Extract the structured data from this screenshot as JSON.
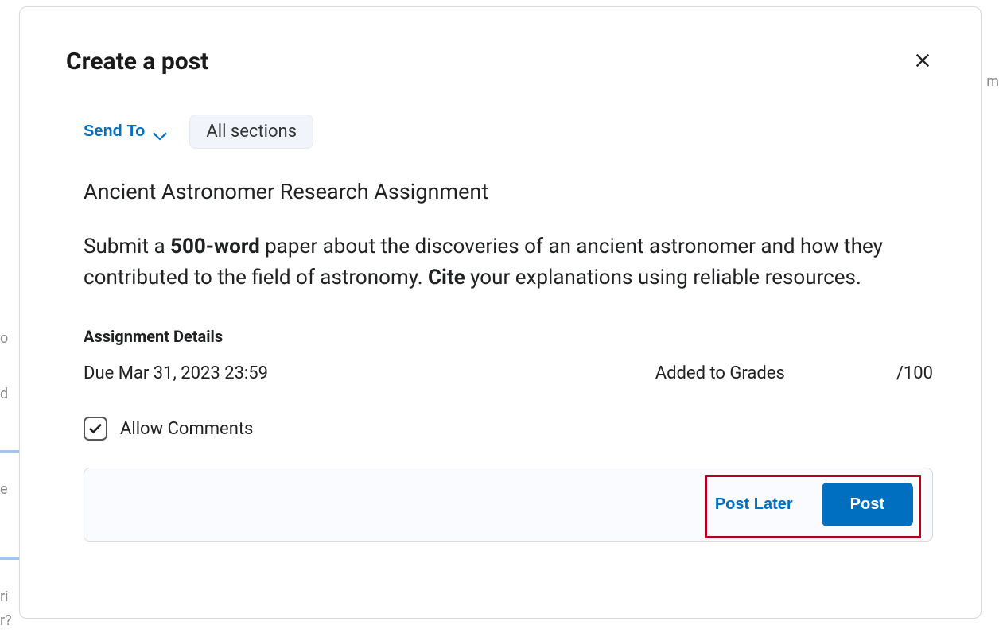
{
  "modal": {
    "title": "Create a post",
    "send_to_label": "Send To",
    "sections_pill": "All sections"
  },
  "post": {
    "title": "Ancient Astronomer Research Assignment",
    "body_prefix": "Submit a ",
    "body_bold1": "500-word",
    "body_mid": " paper about the discoveries of an ancient astronomer and how they contributed to the field of astronomy. ",
    "body_bold2": "Cite",
    "body_suffix": " your explanations using reliable resources."
  },
  "details": {
    "heading": "Assignment Details",
    "due": "Due Mar 31, 2023 23:59",
    "grades": "Added to Grades",
    "max": "/100"
  },
  "comments": {
    "label": "Allow Comments",
    "checked": true
  },
  "footer": {
    "post_later": "Post Later",
    "post": "Post"
  }
}
